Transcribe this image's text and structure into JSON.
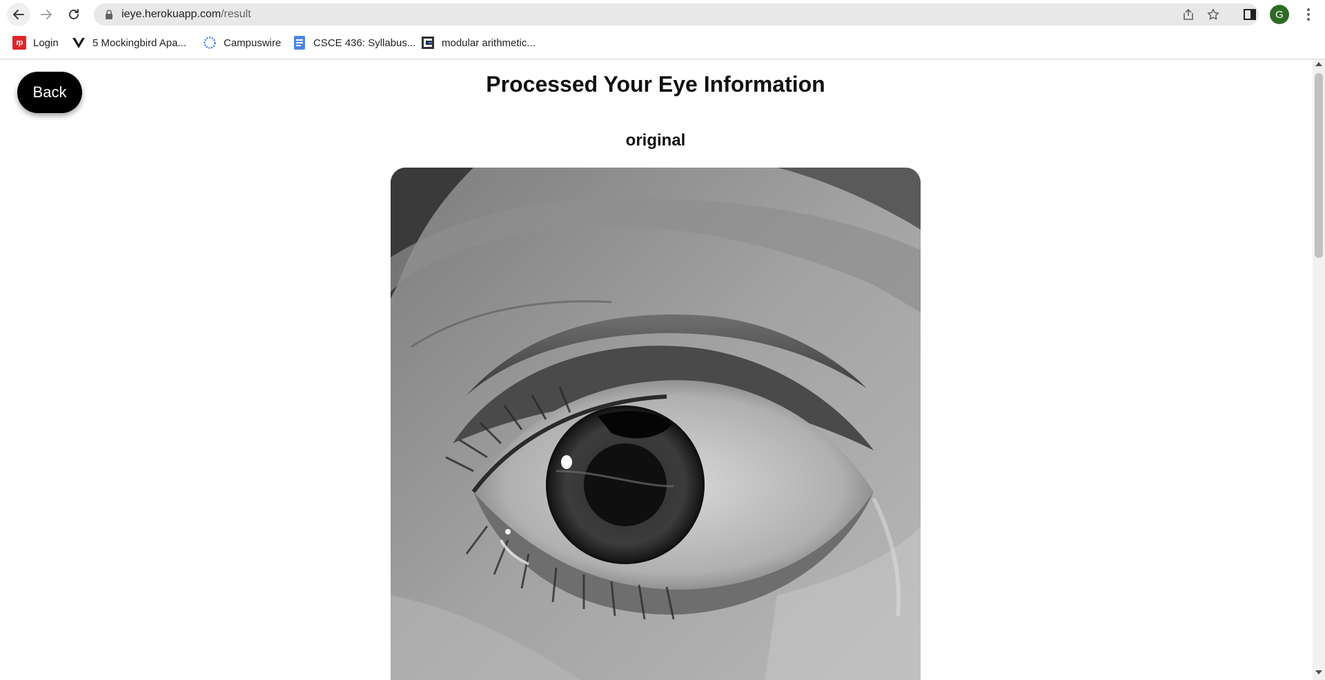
{
  "browser": {
    "url_domain": "ieye.herokuapp.com",
    "url_path": "/result",
    "profile_initial": "G",
    "bookmarks": [
      {
        "label": "Login",
        "icon": "rp-favicon"
      },
      {
        "label": "5 Mockingbird Apa...",
        "icon": "v-logo-favicon"
      },
      {
        "label": "Campuswire",
        "icon": "campuswire-favicon"
      },
      {
        "label": "CSCE 436: Syllabus...",
        "icon": "google-docs-favicon"
      },
      {
        "label": "modular arithmetic...",
        "icon": "c-favicon"
      }
    ]
  },
  "page": {
    "back_label": "Back",
    "title": "Processed Your Eye Information",
    "image_label": "original"
  },
  "colors": {
    "back_button": "#000000",
    "avatar": "#2e6b26",
    "login_favicon": "#e0262b",
    "docs_favicon": "#4a86e8"
  }
}
